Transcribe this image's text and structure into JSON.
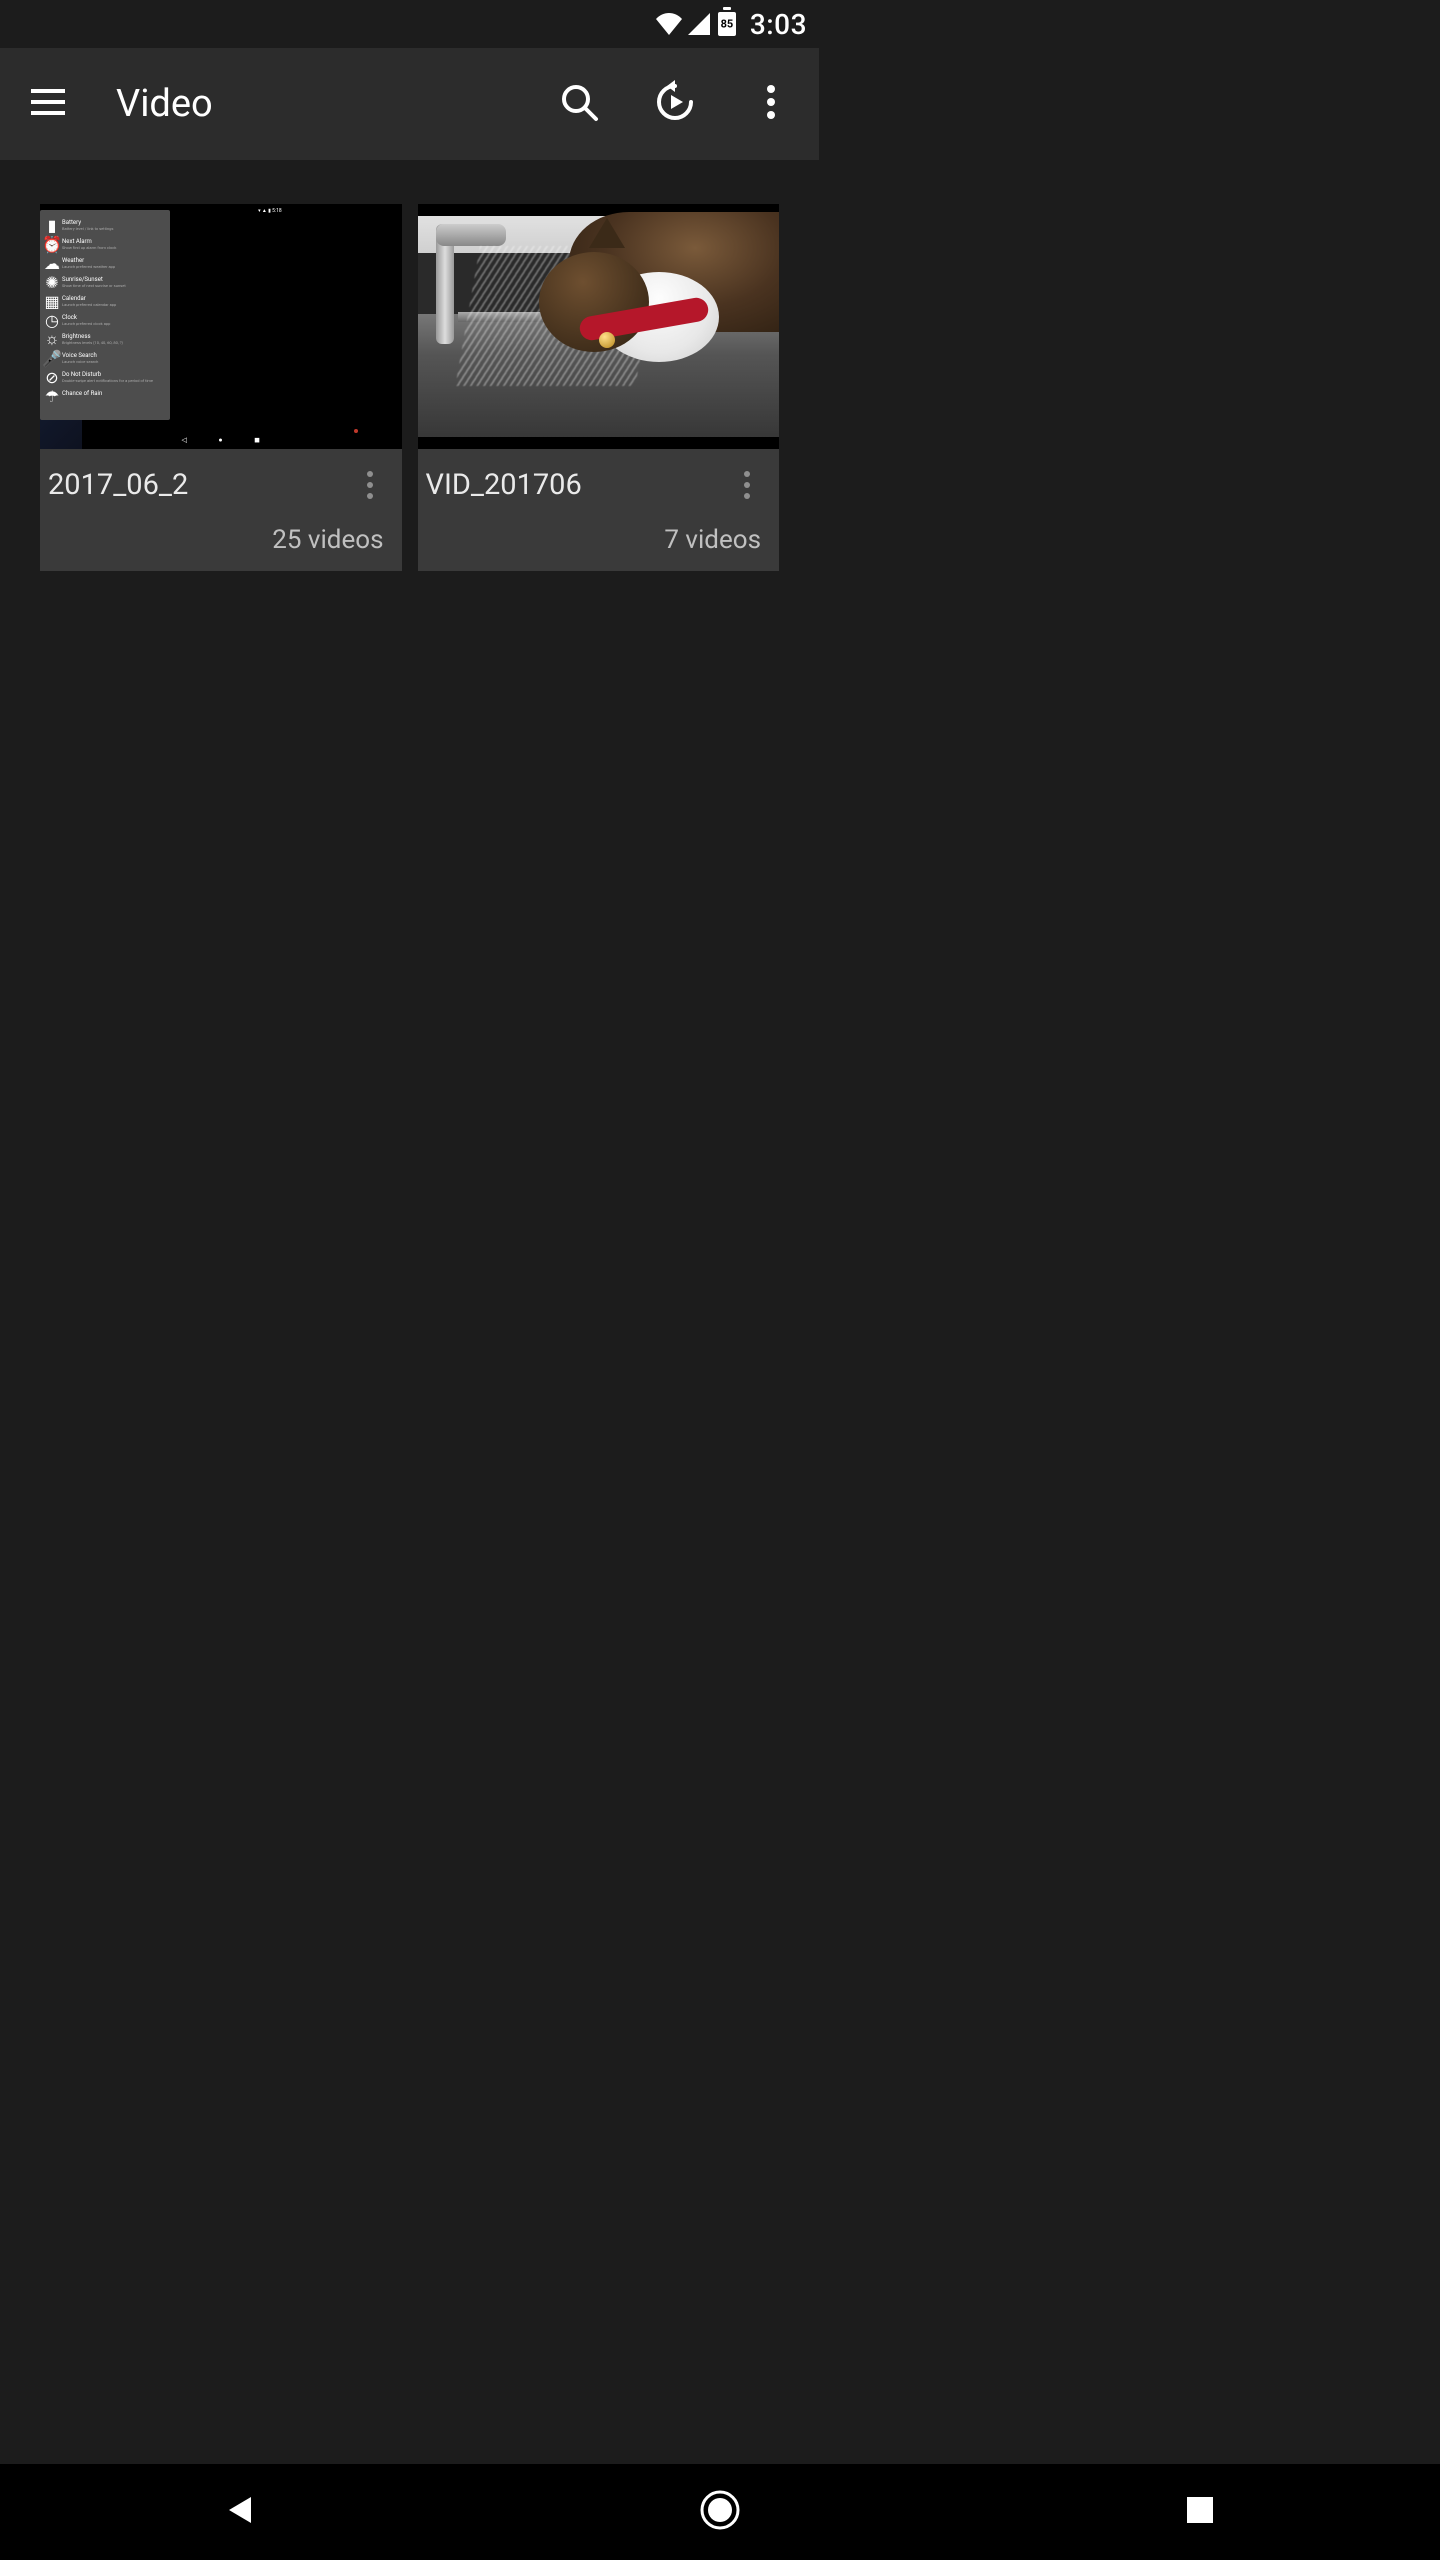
{
  "status_bar": {
    "battery_level": "85",
    "time": "3:03"
  },
  "app_bar": {
    "title": "Video"
  },
  "folders": [
    {
      "name": "2017_06_2",
      "count_label": "25 videos"
    },
    {
      "name": "VID_201706",
      "count_label": "7 videos"
    }
  ],
  "thumb1_rows": [
    {
      "title": "Battery",
      "sub": "Battery level / link to settings"
    },
    {
      "title": "Next Alarm",
      "sub": "Show first up alarm from clock"
    },
    {
      "title": "Weather",
      "sub": "Launch preferred weather app"
    },
    {
      "title": "Sunrise/Sunset",
      "sub": "Show time of next sunrise or sunset"
    },
    {
      "title": "Calendar",
      "sub": "Launch preferred calendar app"
    },
    {
      "title": "Clock",
      "sub": "Launch preferred clock app"
    },
    {
      "title": "Brightness",
      "sub": "Brightness levels (10, 40, 60, 80, ?)"
    },
    {
      "title": "Voice Search",
      "sub": "Launch voice search"
    },
    {
      "title": "Do Not Disturb",
      "sub": "Double-swipe alert notifications for a period of time"
    },
    {
      "title": "Chance of Rain",
      "sub": ""
    }
  ]
}
